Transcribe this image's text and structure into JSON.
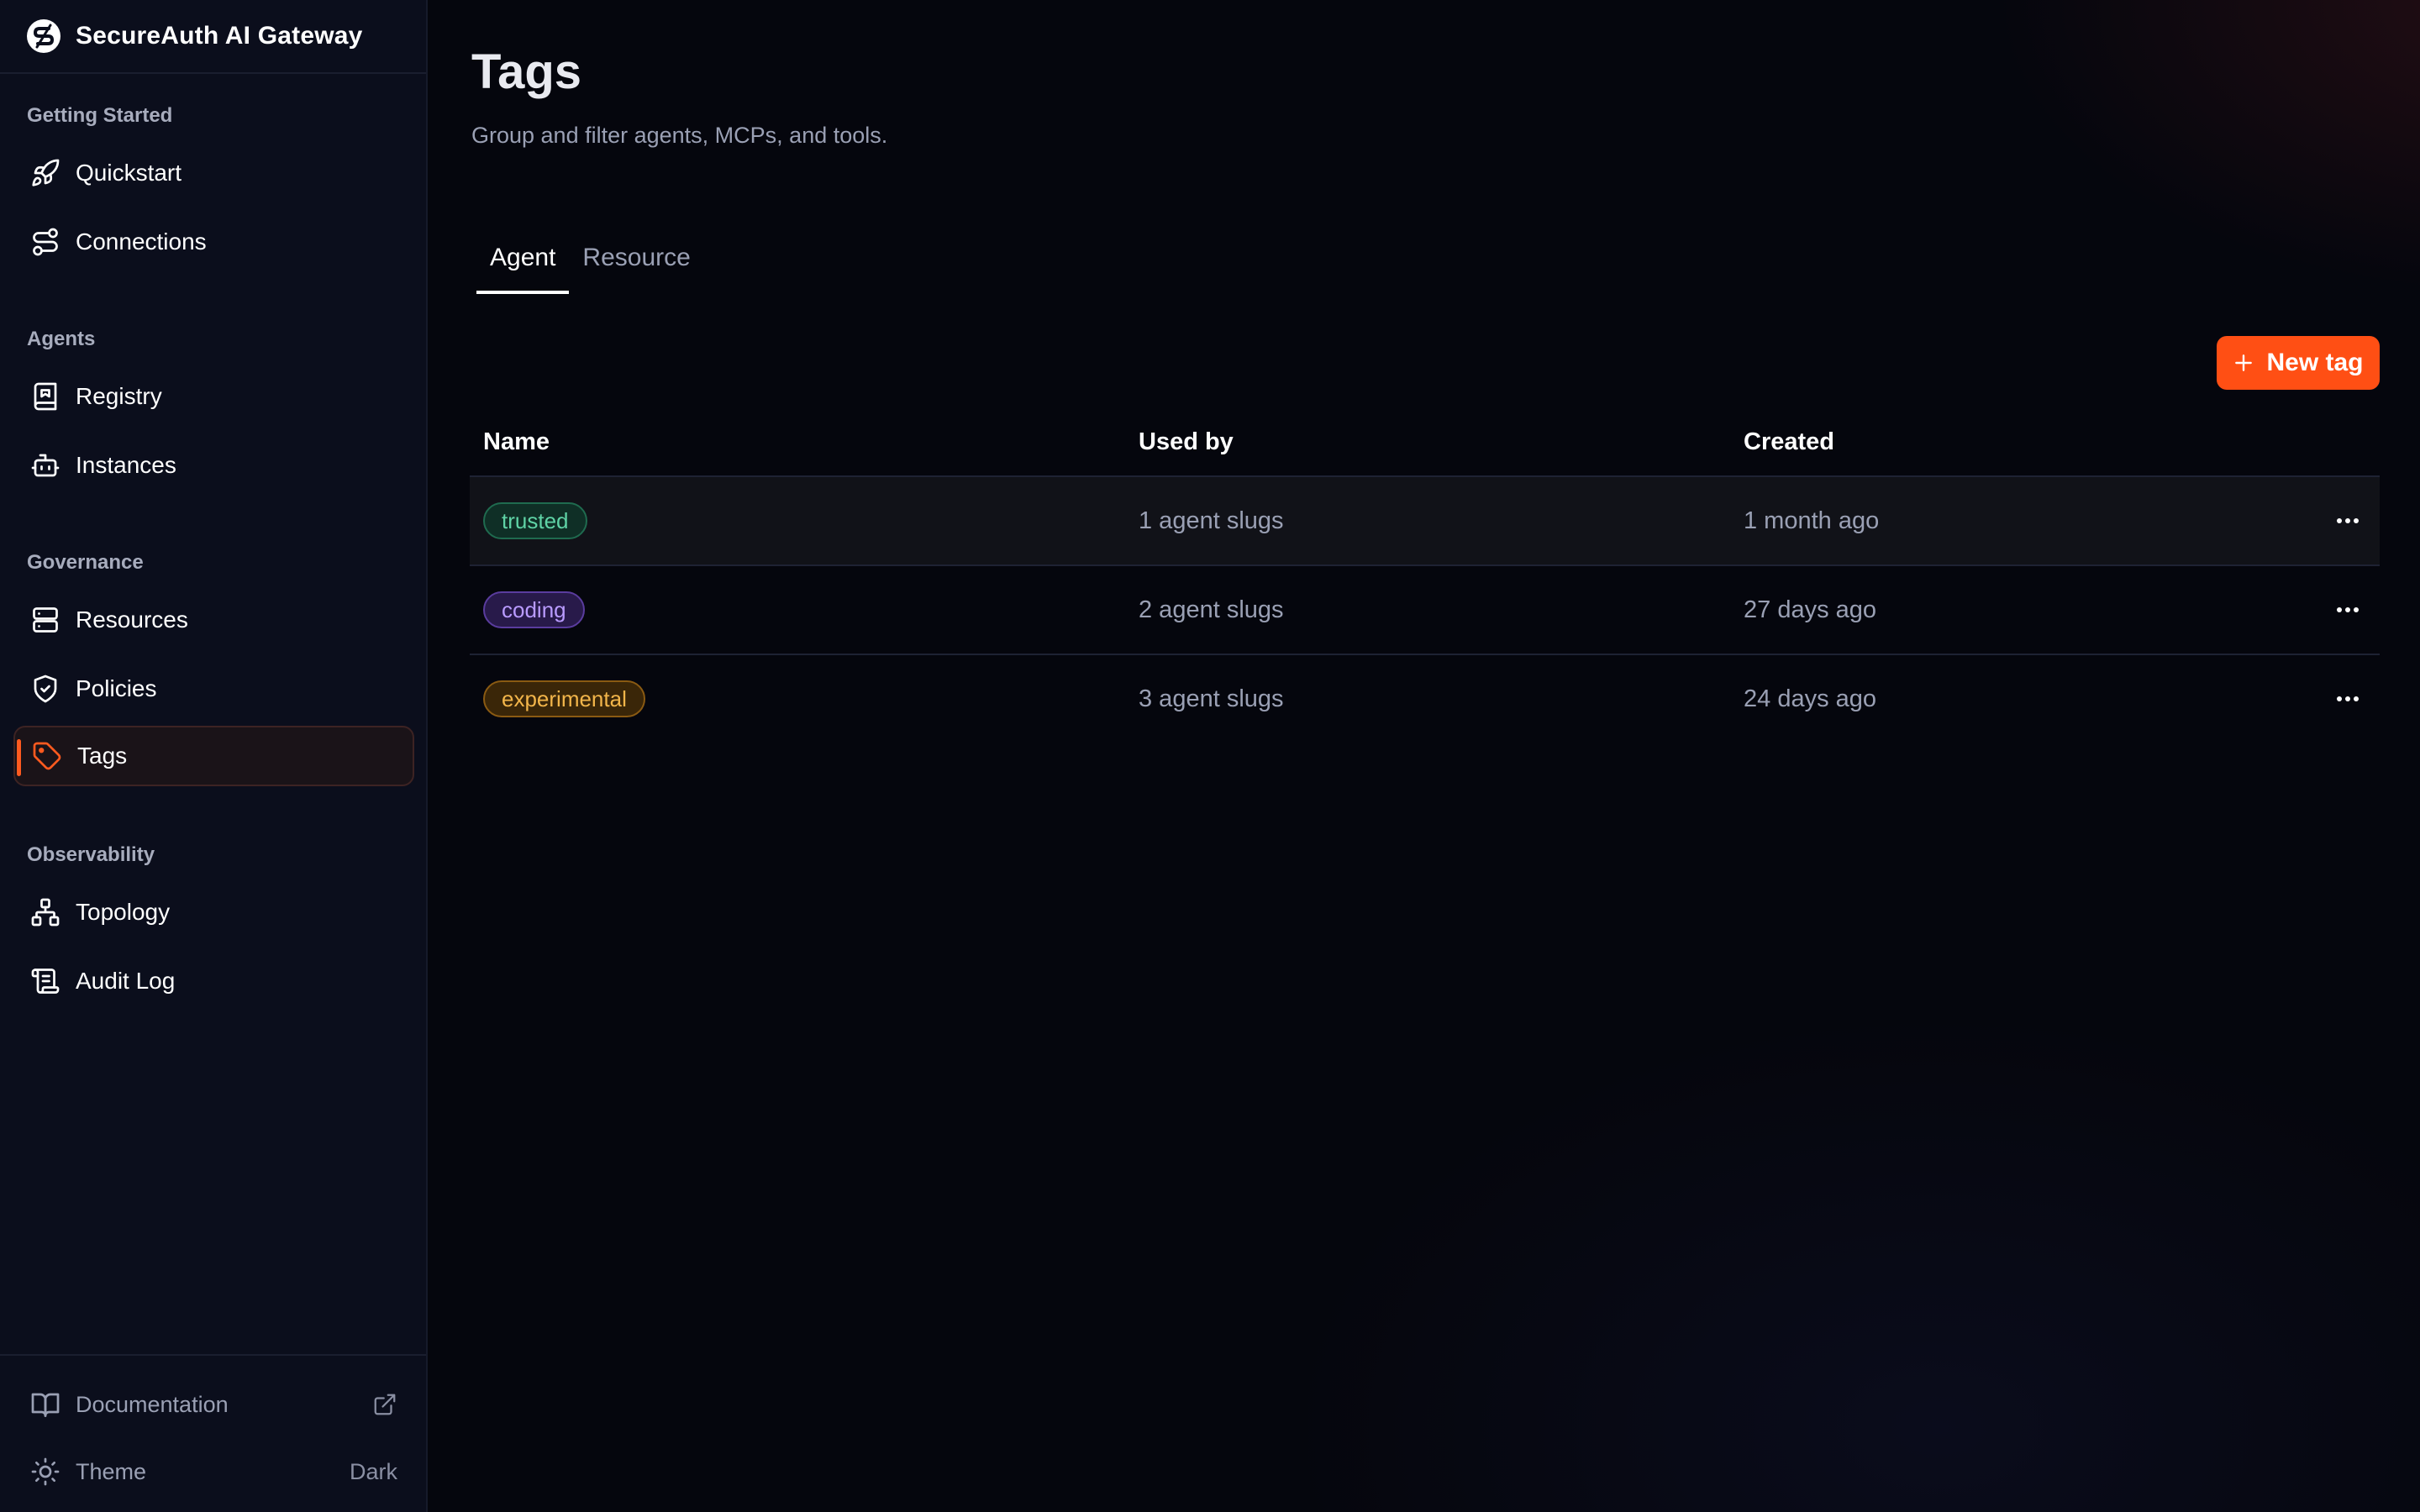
{
  "brand": {
    "name": "SecureAuth AI Gateway",
    "icon": "logo-icon"
  },
  "sidebar": {
    "sections": [
      {
        "label": "Getting Started",
        "items": [
          {
            "label": "Quickstart",
            "icon": "rocket-icon"
          },
          {
            "label": "Connections",
            "icon": "route-icon"
          }
        ]
      },
      {
        "label": "Agents",
        "items": [
          {
            "label": "Registry",
            "icon": "book-icon"
          },
          {
            "label": "Instances",
            "icon": "bot-icon"
          }
        ]
      },
      {
        "label": "Governance",
        "items": [
          {
            "label": "Resources",
            "icon": "server-icon"
          },
          {
            "label": "Policies",
            "icon": "shield-icon"
          },
          {
            "label": "Tags",
            "icon": "tag-icon",
            "active": true
          }
        ]
      },
      {
        "label": "Observability",
        "items": [
          {
            "label": "Topology",
            "icon": "network-icon"
          },
          {
            "label": "Audit Log",
            "icon": "scroll-icon"
          }
        ]
      }
    ],
    "footer": {
      "documentation": {
        "label": "Documentation",
        "icon": "book-open-icon",
        "trailing_icon": "external-link-icon"
      },
      "theme": {
        "label": "Theme",
        "icon": "sun-icon",
        "value": "Dark"
      }
    }
  },
  "page": {
    "title": "Tags",
    "subtitle": "Group and filter agents, MCPs, and tools."
  },
  "tabs": [
    {
      "label": "Agent",
      "active": true
    },
    {
      "label": "Resource",
      "active": false
    }
  ],
  "actions": {
    "new_tag_label": "New tag",
    "new_tag_icon": "plus-icon"
  },
  "table": {
    "columns": [
      "Name",
      "Used by",
      "Created"
    ],
    "rows": [
      {
        "name": "trusted",
        "used_by": "1 agent slugs",
        "created": "1 month ago",
        "color": "green"
      },
      {
        "name": "coding",
        "used_by": "2 agent slugs",
        "created": "27 days ago",
        "color": "purple"
      },
      {
        "name": "experimental",
        "used_by": "3 agent slugs",
        "created": "24 days ago",
        "color": "amber"
      }
    ],
    "row_action_icon": "more-horizontal-icon"
  },
  "colors": {
    "accent": "#ff4f14",
    "badge_green": {
      "bg": "#0f2f26",
      "border": "#1f6b4f",
      "text": "#5fd3a6"
    },
    "badge_purple": {
      "bg": "#281a4a",
      "border": "#5a3c9e",
      "text": "#b99bff"
    },
    "badge_amber": {
      "bg": "#3a2608",
      "border": "#8a5a12",
      "text": "#f2b54a"
    }
  }
}
